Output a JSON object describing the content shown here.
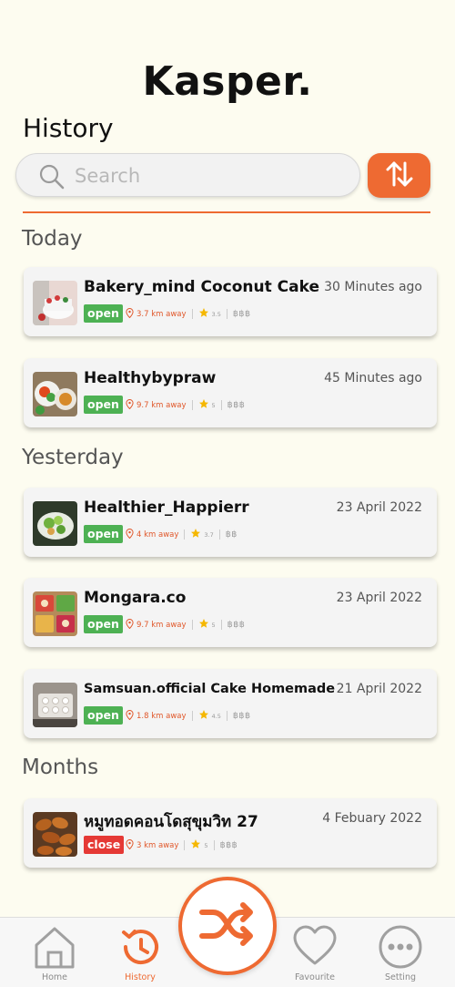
{
  "app": {
    "brand": "Kasper.",
    "page_title": "History"
  },
  "search": {
    "placeholder": "Search"
  },
  "sections": {
    "today": "Today",
    "yesterday": "Yesterday",
    "months": "Months"
  },
  "history": [
    {
      "name": "Bakery_mind Coconut Cake",
      "time": "30 Minutes ago",
      "status": "open",
      "distance": "3.7 km away",
      "rating": "3.5",
      "price": "฿฿฿"
    },
    {
      "name": "Healthybypraw",
      "time": "45 Minutes ago",
      "status": "open",
      "distance": "9.7 km away",
      "rating": "5",
      "price": "฿฿฿"
    },
    {
      "name": "Healthier_Happierr",
      "time": "23 April 2022",
      "status": "open",
      "distance": "4 km away",
      "rating": "3.7",
      "price": "฿฿"
    },
    {
      "name": "Mongara.co",
      "time": "23 April 2022",
      "status": "open",
      "distance": "9.7 km away",
      "rating": "5",
      "price": "฿฿฿"
    },
    {
      "name": "Samsuan.official Cake Homemade",
      "time": "21 April 2022",
      "status": "open",
      "distance": "1.8 km away",
      "rating": "4.5",
      "price": "฿฿฿"
    },
    {
      "name": "หมูทอดคอนโดสุขุมวิท 27",
      "time": "4 Febuary 2022",
      "status": "close",
      "distance": "3 km away",
      "rating": "5",
      "price": "฿฿฿"
    }
  ],
  "nav": {
    "home": "Home",
    "history": "History",
    "favourite": "Favourite",
    "setting": "Setting"
  },
  "colors": {
    "accent": "#EE6A32",
    "open": "#4DB153",
    "close": "#E53935",
    "background": "#FDFCF0"
  },
  "icons": {
    "search": "search-icon",
    "sort": "sort-arrows-icon",
    "location": "location-pin-icon",
    "star": "star-icon",
    "home": "home-icon",
    "history": "history-icon",
    "shuffle": "shuffle-icon",
    "favourite": "heart-icon",
    "setting": "more-dots-icon"
  }
}
